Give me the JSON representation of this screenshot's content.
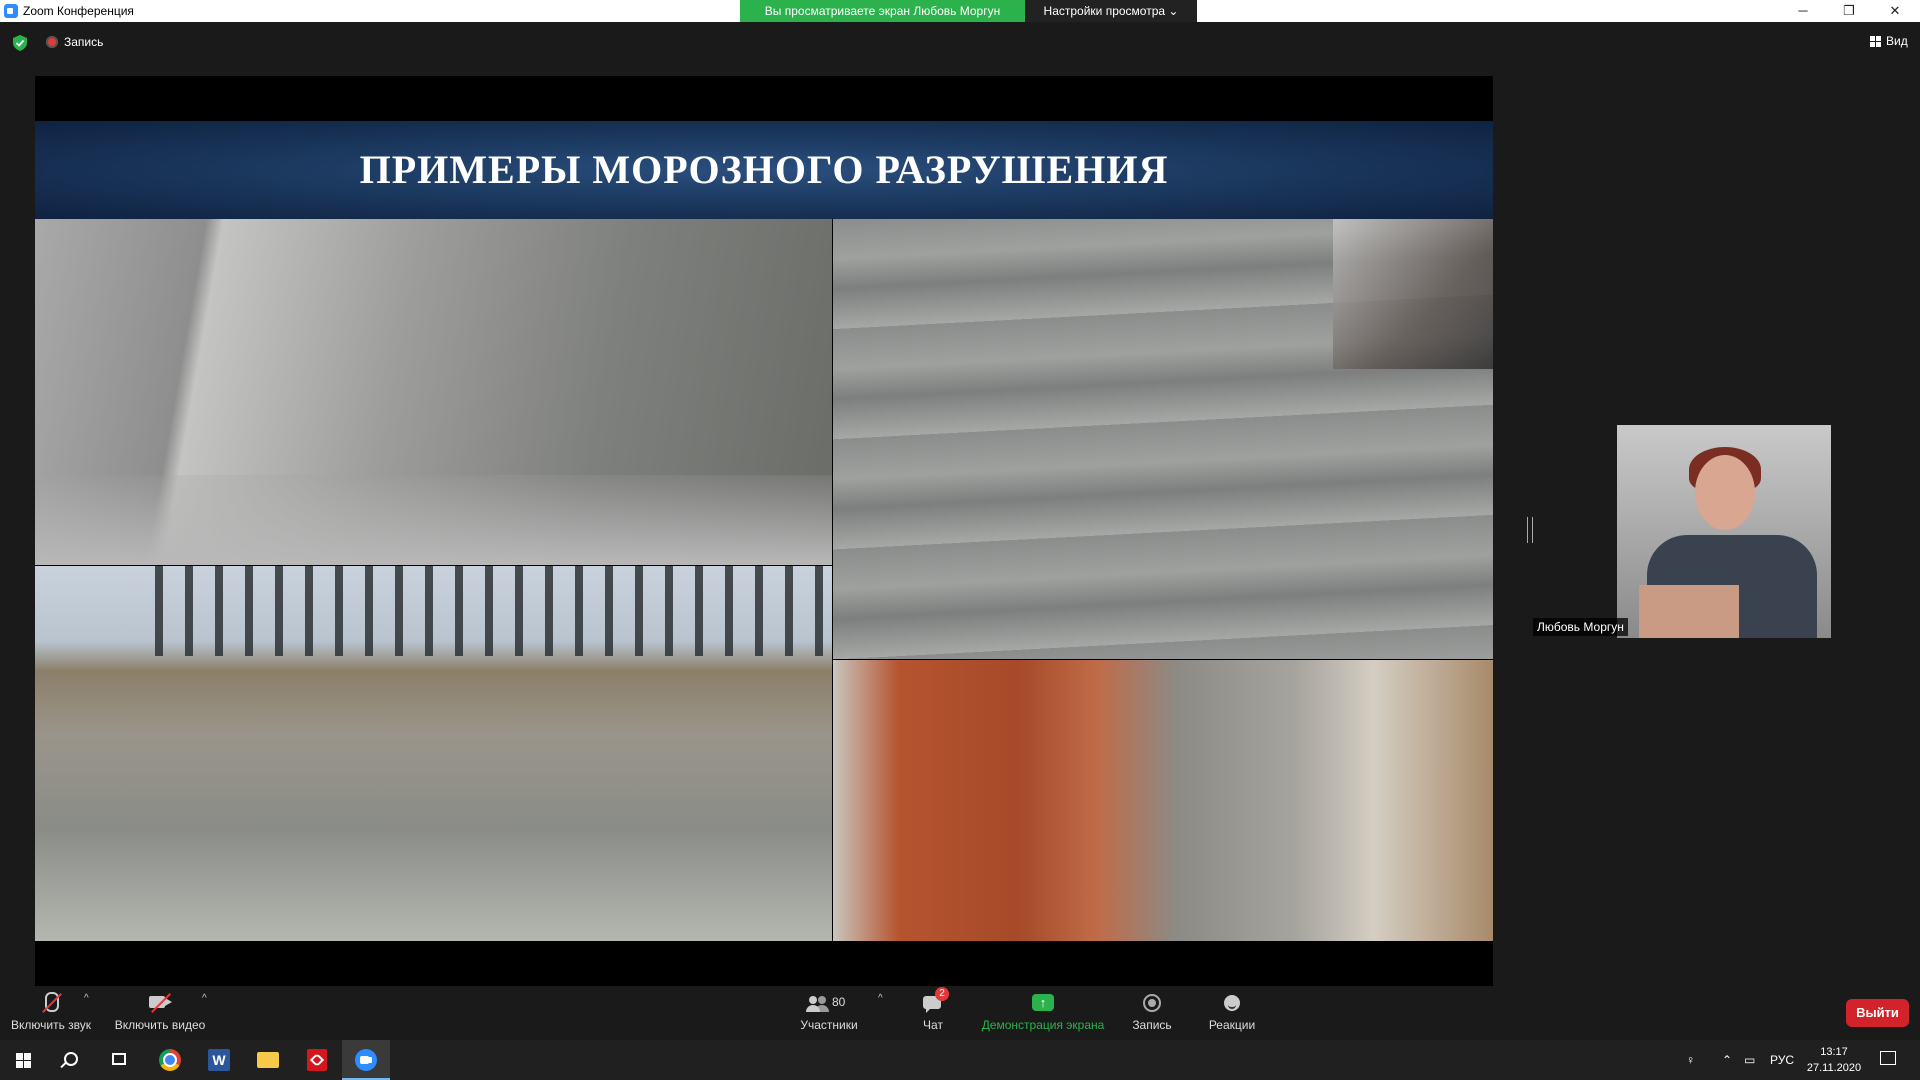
{
  "window": {
    "title": "Zoom Конференция",
    "share_banner": "Вы просматриваете экран Любовь Моргун",
    "view_settings": "Настройки просмотра",
    "controls": {
      "minimize": "─",
      "restore": "❐",
      "close": "✕"
    }
  },
  "meeting": {
    "recording_label": "Запись",
    "view_label": "Вид"
  },
  "slide": {
    "title": "ПРИМЕРЫ МОРОЗНОГО РАЗРУШЕНИЯ"
  },
  "participant": {
    "name": "Любовь Моргун"
  },
  "toolbar": {
    "unmute_label": "Включить звук",
    "start_video_label": "Включить видео",
    "participants_label": "Участники",
    "participants_count": "80",
    "chat_label": "Чат",
    "chat_badge": "2",
    "share_label": "Демонстрация экрана",
    "record_label": "Запись",
    "reactions_label": "Реакции",
    "leave_label": "Выйти",
    "caret": "^",
    "share_arrow": "↑"
  },
  "taskbar": {
    "lang": "РУС",
    "time": "13:17",
    "date": "27.11.2020",
    "word_letter": "W"
  },
  "colors": {
    "share_green": "#2bb24c",
    "leave_red": "#d2232a",
    "zoom_blue": "#2d8cff"
  }
}
